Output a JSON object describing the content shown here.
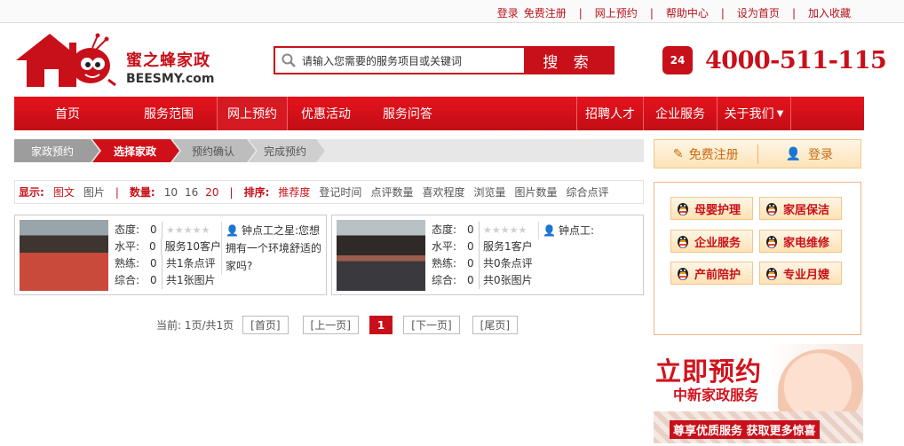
{
  "top_links": [
    "登录",
    "免费注册",
    "网上预约",
    "帮助中心",
    "设为首页",
    "加入收藏"
  ],
  "logo": {
    "cn": "蜜之蜂家政",
    "en": "BEESMY.com"
  },
  "search": {
    "placeholder": "请输入您需要的服务项目或关键词",
    "button": "搜 索",
    "icon": "search-icon"
  },
  "hotline": {
    "icon": "24h-phone-icon",
    "badge": "24",
    "number": "4000-511-115"
  },
  "nav": {
    "items": [
      "首页",
      "服务范围",
      "网上预约",
      "优惠活动",
      "服务问答",
      "招聘人才",
      "企业服务",
      "关于我们"
    ],
    "active_index": 2
  },
  "steps": [
    "家政预约",
    "选择家政",
    "预约确认",
    "完成预约"
  ],
  "filter": {
    "display_label": "显示:",
    "display_opts": [
      "图文",
      "图片"
    ],
    "count_label": "数量:",
    "count_opts": [
      "10",
      "16",
      "20"
    ],
    "sort_label": "排序:",
    "sort_opts": [
      "推荐度",
      "登记时间",
      "点评数量",
      "喜欢程度",
      "浏览量",
      "图片数量",
      "综合点评"
    ]
  },
  "cards": [
    {
      "stats": [
        {
          "k": "态度:",
          "v": "0",
          "r": "stars"
        },
        {
          "k": "水平:",
          "v": "0",
          "r": "服务10客户"
        },
        {
          "k": "熟练:",
          "v": "0",
          "r": "共1条点评"
        },
        {
          "k": "综合:",
          "v": "0",
          "r": "共1张图片"
        }
      ],
      "quote_user": "钟点工之星:",
      "quote_text": "您想拥有一个环境舒适的家吗?"
    },
    {
      "stats": [
        {
          "k": "态度:",
          "v": "0",
          "r": "stars"
        },
        {
          "k": "水平:",
          "v": "0",
          "r": "服务1客户"
        },
        {
          "k": "熟练:",
          "v": "0",
          "r": "共0条点评"
        },
        {
          "k": "综合:",
          "v": "0",
          "r": "共0张图片"
        }
      ],
      "quote_user": "钟点工:",
      "quote_text": ""
    }
  ],
  "pager": {
    "info": "当前: 1页/共1页",
    "first": "[首页]",
    "prev": "[上一页]",
    "current": "1",
    "next": "[下一页]",
    "last": "[尾页]"
  },
  "auth": {
    "register": "免费注册",
    "login": "登录"
  },
  "services": [
    "母婴护理",
    "家居保洁",
    "企业服务",
    "家电维修",
    "产前陪护",
    "专业月嫂"
  ],
  "banner": {
    "title": "立即预约",
    "subtitle": "中新家政服务",
    "slogan": "尊享优质服务 获取更多惊喜"
  },
  "colors": {
    "brand_red": "#c8101a",
    "accent_orange": "#c86b12"
  }
}
